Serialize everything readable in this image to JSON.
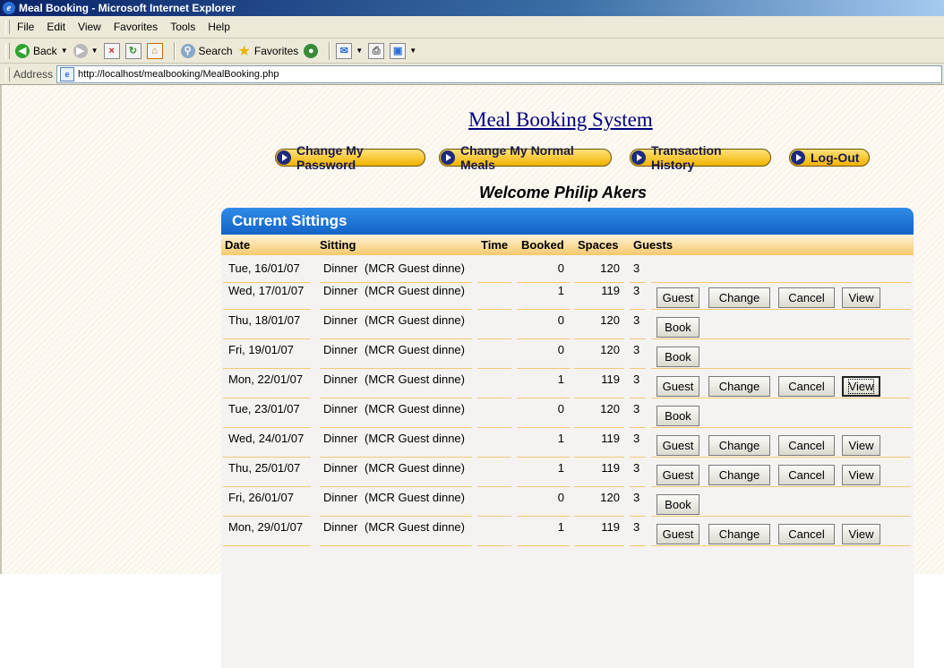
{
  "window": {
    "title": "Meal Booking - Microsoft Internet Explorer"
  },
  "menu": [
    "File",
    "Edit",
    "View",
    "Favorites",
    "Tools",
    "Help"
  ],
  "toolbar": {
    "back": "Back",
    "search": "Search",
    "favorites": "Favorites"
  },
  "address": {
    "label": "Address",
    "url": "http://localhost/mealbooking/MealBooking.php"
  },
  "site": {
    "title": "Meal Booking System",
    "welcome": "Welcome Philip Akers"
  },
  "nav": {
    "change_password": "Change My Password",
    "change_meals": "Change My Normal Meals",
    "transactions": "Transaction History",
    "logout": "Log-Out"
  },
  "panel": {
    "title": "Current Sittings",
    "columns": {
      "date": "Date",
      "sitting": "Sitting",
      "time": "Time",
      "booked": "Booked",
      "spaces": "Spaces",
      "guests": "Guests"
    },
    "buttons": {
      "guest": "Guest",
      "change": "Change",
      "cancel": "Cancel",
      "view": "View",
      "book": "Book"
    },
    "rows": [
      {
        "date": "Tue, 16/01/07",
        "meal": "Dinner",
        "desc": "(MCR Guest dinne)",
        "booked": "0",
        "spaces": "120",
        "guests": "3"
      },
      {
        "date": "Wed, 17/01/07",
        "meal": "Dinner",
        "desc": "(MCR Guest dinne)",
        "booked": "1",
        "spaces": "119",
        "guests": "3"
      },
      {
        "date": "Thu, 18/01/07",
        "meal": "Dinner",
        "desc": "(MCR Guest dinne)",
        "booked": "0",
        "spaces": "120",
        "guests": "3"
      },
      {
        "date": "Fri, 19/01/07",
        "meal": "Dinner",
        "desc": "(MCR Guest dinne)",
        "booked": "0",
        "spaces": "120",
        "guests": "3"
      },
      {
        "date": "Mon, 22/01/07",
        "meal": "Dinner",
        "desc": "(MCR Guest dinne)",
        "booked": "1",
        "spaces": "119",
        "guests": "3"
      },
      {
        "date": "Tue, 23/01/07",
        "meal": "Dinner",
        "desc": "(MCR Guest dinne)",
        "booked": "0",
        "spaces": "120",
        "guests": "3"
      },
      {
        "date": "Wed, 24/01/07",
        "meal": "Dinner",
        "desc": "(MCR Guest dinne)",
        "booked": "1",
        "spaces": "119",
        "guests": "3"
      },
      {
        "date": "Thu, 25/01/07",
        "meal": "Dinner",
        "desc": "(MCR Guest dinne)",
        "booked": "1",
        "spaces": "119",
        "guests": "3"
      },
      {
        "date": "Fri, 26/01/07",
        "meal": "Dinner",
        "desc": "(MCR Guest dinne)",
        "booked": "0",
        "spaces": "120",
        "guests": "3"
      },
      {
        "date": "Mon, 29/01/07",
        "meal": "Dinner",
        "desc": "(MCR Guest dinne)",
        "booked": "1",
        "spaces": "119",
        "guests": "3"
      }
    ]
  }
}
